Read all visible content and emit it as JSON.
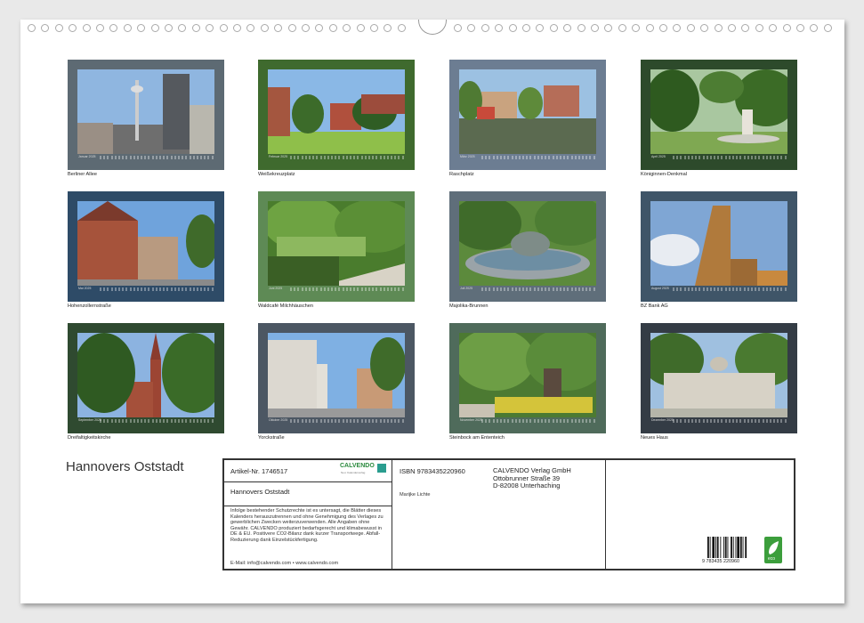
{
  "calendar": {
    "title": "Hannovers Oststadt",
    "months": [
      {
        "label": "Januar 2025",
        "caption": "Berliner Allee",
        "frame": "#5d6a73"
      },
      {
        "label": "Februar 2025",
        "caption": "Weißekreuzplatz",
        "frame": "#3f6a2e"
      },
      {
        "label": "März 2025",
        "caption": "Raschplatz",
        "frame": "#6c7d92"
      },
      {
        "label": "April 2025",
        "caption": "Königinnen-Denkmal",
        "frame": "#2d4a2b"
      },
      {
        "label": "Mai 2025",
        "caption": "Hohenzollernstraße",
        "frame": "#2e4b67"
      },
      {
        "label": "Juni 2025",
        "caption": "Waldcafé Milchhäuschen",
        "frame": "#5e8a55"
      },
      {
        "label": "Juli 2025",
        "caption": "Majolika-Brunnen",
        "frame": "#5f6e7a"
      },
      {
        "label": "August 2025",
        "caption": "BZ Bank AG",
        "frame": "#3f5568"
      },
      {
        "label": "September 2025",
        "caption": "Dreifaltigkeitskirche",
        "frame": "#2f4a30"
      },
      {
        "label": "Oktober 2025",
        "caption": "Yorckstraße",
        "frame": "#4c5763"
      },
      {
        "label": "November 2025",
        "caption": "Steinbock am Ententeich",
        "frame": "#4f6b5b"
      },
      {
        "label": "Dezember 2025",
        "caption": "Neues Haus",
        "frame": "#343c45"
      }
    ]
  },
  "info": {
    "article": "Artikel-Nr. 1746517",
    "brand": "CALVENDO",
    "brand_sub": "Neu: Kalenderverlag",
    "product_title": "Hannovers Oststadt",
    "legal": "Infolge bestehender Schutzrechte ist es untersagt, die Blätter dieses Kalenders herauszutrennen und ohne Genehmigung des Verlages zu gewerblichen Zwecken weiterzuverwenden. Alle Angaben ohne Gewähr. CALVENDO produziert bedarfsgerecht und klimabewusst in DE & EU. Positivere CO2-Bilanz dank kurzer Transportwege. Abfall-Reduzierung dank Einzelstückfertigung.",
    "contact": "E-Mail: info@calvendo.com • www.calvendo.com",
    "isbn": "ISBN 9783435220960",
    "author": "Marijke Lichte",
    "publisher_name": "CALVENDO Verlag GmbH",
    "publisher_street": "Ottobrunner Straße 39",
    "publisher_city": "D-82008 Unterhaching",
    "barcode_digits": "9 783435 220960",
    "eco_label": "eco"
  }
}
